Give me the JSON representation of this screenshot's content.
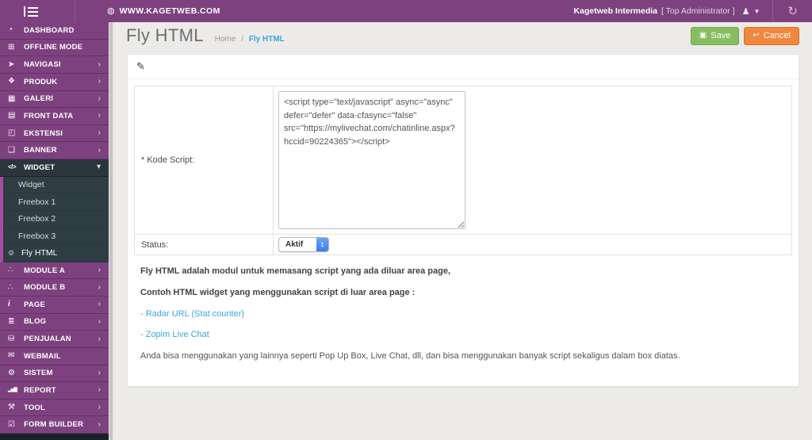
{
  "topbar": {
    "site_url": "WWW.KAGETWEB.COM",
    "user_name": "Kagetweb Intermedia",
    "user_role": "[ Top Administrator ]",
    "icons": {
      "globe": "◍",
      "user": "♟",
      "caret": "▼",
      "refresh": "↻"
    }
  },
  "colors": {
    "brand_purple": "#7e4180",
    "submenu_accent": "#a94c9e",
    "link_blue": "#3ba5db",
    "save_green": "#87bd5f",
    "cancel_orange": "#f0873f"
  },
  "sidebar": {
    "items": [
      {
        "label": "DASHBOARD",
        "icon": "dashboard-icon",
        "glyph": "◔"
      },
      {
        "label": "OFFLINE MODE",
        "icon": "offline-mode-icon",
        "glyph": "⊞"
      },
      {
        "label": "NAVIGASI",
        "icon": "navigation-arrow-icon",
        "glyph": "➤",
        "chevron": "right"
      },
      {
        "label": "PRODUK",
        "icon": "product-tags-icon",
        "glyph": "❖",
        "chevron": "right"
      },
      {
        "label": "GALERI",
        "icon": "gallery-image-icon",
        "glyph": "▦",
        "chevron": "right"
      },
      {
        "label": "FRONT DATA",
        "icon": "front-data-icon",
        "glyph": "▤",
        "chevron": "right"
      },
      {
        "label": "EKSTENSI",
        "icon": "extension-puzzle-icon",
        "glyph": "◰",
        "chevron": "right"
      },
      {
        "label": "BANNER",
        "icon": "banner-icon",
        "glyph": "❑",
        "chevron": "right"
      },
      {
        "label": "WIDGET",
        "icon": "widget-code-icon",
        "glyph": "</>",
        "chevron": "down",
        "dark": true,
        "submenu": [
          {
            "label": "Widget"
          },
          {
            "label": "Freebox 1"
          },
          {
            "label": "Freebox 2"
          },
          {
            "label": "Freebox 3"
          },
          {
            "label": "Fly HTML",
            "icon": "gear-icon",
            "glyph": "⚙",
            "active": true
          }
        ]
      },
      {
        "label": "MODULE A",
        "icon": "module-share-icon",
        "glyph": "∴",
        "chevron": "right"
      },
      {
        "label": "MODULE B",
        "icon": "module-share-icon",
        "glyph": "∴",
        "chevron": "right"
      },
      {
        "label": "PAGE",
        "icon": "page-info-icon",
        "glyph": "i",
        "chevron": "right"
      },
      {
        "label": "BLOG",
        "icon": "blog-list-icon",
        "glyph": "≣",
        "chevron": "right"
      },
      {
        "label": "PENJUALAN",
        "icon": "cart-icon",
        "glyph": "⛁",
        "chevron": "right"
      },
      {
        "label": "WEBMAIL",
        "icon": "envelope-icon",
        "glyph": "✉"
      },
      {
        "label": "SISTEM",
        "icon": "gear-icon",
        "glyph": "⚙",
        "chevron": "right"
      },
      {
        "label": "REPORT",
        "icon": "bar-chart-icon",
        "glyph": "▂▅▇",
        "chevron": "right"
      },
      {
        "label": "TOOL",
        "icon": "wrench-icon",
        "glyph": "⚒",
        "chevron": "right"
      },
      {
        "label": "FORM BUILDER",
        "icon": "form-check-icon",
        "glyph": "☑",
        "chevron": "right"
      }
    ],
    "chevron_right_glyph": "›",
    "chevron_down_glyph": "▾"
  },
  "main": {
    "page_title": "Fly HTML",
    "breadcrumb": {
      "home": "Home",
      "separator": "/",
      "current": "Fly HTML"
    },
    "save_label": "Save",
    "cancel_label": "Cancel",
    "save_icon_glyph": "▣",
    "cancel_icon_glyph": "↩",
    "pencil_icon_glyph": "✎",
    "form": {
      "kode_label": "* Kode Script:",
      "kode_value": "<script type=\"text/javascript\" async=\"async\" defer=\"defer\" data-cfasync=\"false\" src=\"https://mylivechat.com/chatinline.aspx?hccid=90224365\"></script>",
      "status_label": "Status:",
      "status_value": "Aktif"
    },
    "help": [
      {
        "style": "bold",
        "text": "Fly HTML adalah modul untuk memasang script yang ada diluar area page,"
      },
      {
        "style": "bold",
        "text": "Contoh HTML widget yang menggunakan script di luar area page :"
      },
      {
        "style": "link",
        "text": "- Radar URL (Stat counter)"
      },
      {
        "style": "link",
        "text": "- Zopim Live Chat"
      },
      {
        "style": "normal",
        "text": "Anda bisa menggunakan yang lainnya seperti Pop Up Box, Live Chat, dll, dan bisa menggunakan banyak script sekaligus dalam box diatas."
      }
    ]
  }
}
